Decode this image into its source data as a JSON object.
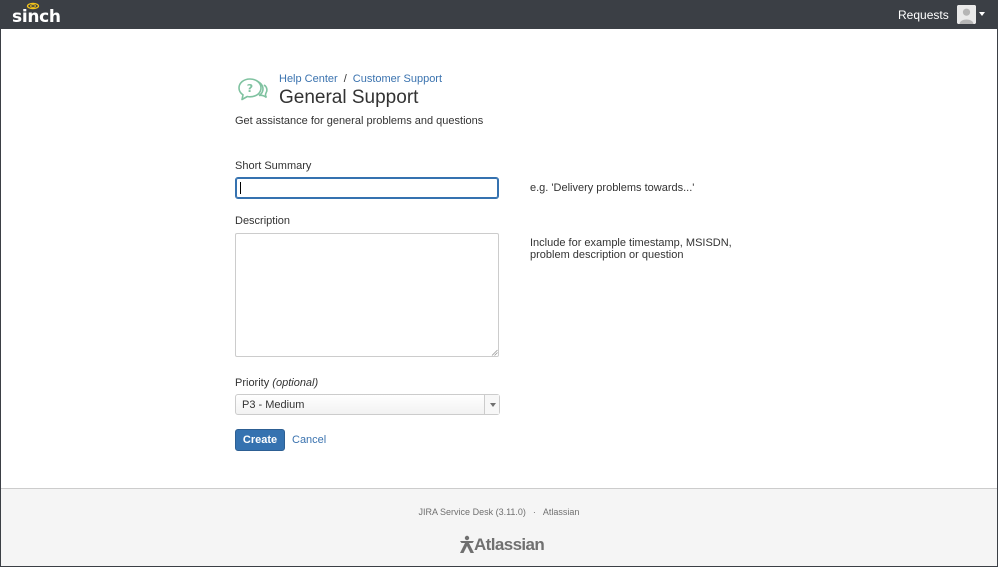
{
  "topbar": {
    "logo_text": "sinch",
    "requests_label": "Requests",
    "avatar_icon": "user-avatar-icon",
    "background": "#3b3f45"
  },
  "header": {
    "breadcrumb": [
      "Help Center",
      "Customer Support"
    ],
    "breadcrumb_separator": "/",
    "title": "General Support",
    "description": "Get assistance for general problems and questions",
    "icon": "help-chat-icon"
  },
  "form": {
    "summary": {
      "label": "Short Summary",
      "value": "",
      "hint": "e.g. 'Delivery problems towards...'"
    },
    "description": {
      "label": "Description",
      "value": "",
      "hint_line1": "Include for example timestamp, MSISDN,",
      "hint_line2": "problem description or question"
    },
    "priority": {
      "label": "Priority",
      "label_optional": "(optional)",
      "selected": "P3 - Medium"
    },
    "create_label": "Create",
    "cancel_label": "Cancel"
  },
  "footer": {
    "product": "JIRA Service Desk (3.11.0)",
    "separator": "·",
    "company": "Atlassian",
    "logo_text": "Atlassian"
  },
  "colors": {
    "accent": "#3572b0",
    "link": "#3b73af",
    "icon_green": "#7fc2a0"
  }
}
